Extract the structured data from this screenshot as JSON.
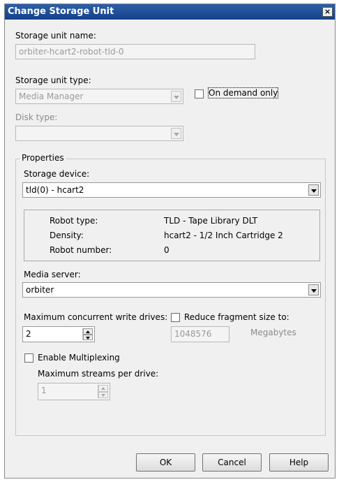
{
  "dialog": {
    "title": "Change Storage Unit",
    "close_glyph": "×"
  },
  "storage_unit_name": {
    "label": "Storage unit name:",
    "value": "orbiter-hcart2-robot-tld-0"
  },
  "storage_unit_type": {
    "label": "Storage unit type:",
    "value": "Media Manager"
  },
  "on_demand_only": {
    "label": "On demand only",
    "checked": false
  },
  "disk_type": {
    "label": "Disk type:",
    "value": ""
  },
  "properties": {
    "legend": "Properties",
    "storage_device": {
      "label": "Storage device:",
      "value": "tld(0) - hcart2"
    },
    "info": {
      "robot_type_label": "Robot type:",
      "robot_type_value": "TLD - Tape Library DLT",
      "density_label": "Density:",
      "density_value": "hcart2 - 1/2 Inch Cartridge 2",
      "robot_number_label": "Robot number:",
      "robot_number_value": "0"
    },
    "media_server": {
      "label": "Media server:",
      "value": "orbiter"
    },
    "max_write_drives": {
      "label": "Maximum concurrent write drives:",
      "value": "2"
    },
    "reduce_fragment": {
      "label": "Reduce fragment size to:",
      "checked": false,
      "value": "1048576",
      "unit": "Megabytes"
    },
    "multiplexing": {
      "label": "Enable Multiplexing",
      "checked": false,
      "streams_label": "Maximum streams per drive:",
      "streams_value": "1"
    }
  },
  "buttons": {
    "ok": "OK",
    "cancel": "Cancel",
    "help": "Help"
  },
  "colors": {
    "title_bar": "#1f4f9a",
    "dialog_bg": "#f0f0f0"
  }
}
